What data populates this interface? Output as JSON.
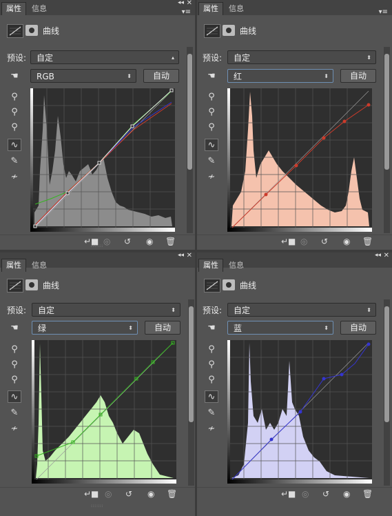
{
  "tabs": {
    "properties": "属性",
    "info": "信息"
  },
  "header_title": "曲线",
  "preset_label": "预设:",
  "preset_value": "自定",
  "auto_label": "自动",
  "channels": {
    "rgb": "RGB",
    "red": "红",
    "green": "绿",
    "blue": "蓝"
  },
  "icons": {
    "curves_adjustment": "curves-icon",
    "mask": "mask-icon",
    "hand": "hand-icon",
    "eyedropper": "eyedropper-icon",
    "curve_tool": "curve-tool-icon",
    "pencil": "pencil-icon",
    "smooth": "smooth-icon",
    "clip": "clip-to-layer-icon",
    "view_previous": "view-previous-icon",
    "reset": "reset-icon",
    "visibility": "eye-icon",
    "delete": "trash-icon"
  },
  "colors": {
    "panel": "#535353",
    "rgb_hist": "#8c8c8c",
    "red_hist": "#f5c2ad",
    "green_hist": "#c6f4b2",
    "blue_hist": "#d2d1f4",
    "red_curve": "#cc3b2b",
    "green_curve": "#36b521",
    "blue_curve": "#3535d0"
  }
}
